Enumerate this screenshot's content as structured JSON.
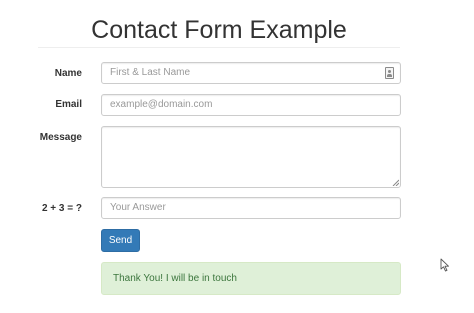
{
  "title": "Contact Form Example",
  "form": {
    "name": {
      "label": "Name",
      "placeholder": "First & Last Name",
      "value": ""
    },
    "email": {
      "label": "Email",
      "placeholder": "example@domain.com",
      "value": ""
    },
    "message": {
      "label": "Message",
      "value": ""
    },
    "captcha": {
      "label": "2 + 3 = ?",
      "placeholder": "Your Answer",
      "value": ""
    },
    "send_label": "Send"
  },
  "alert": {
    "text": "Thank You! I will be in touch",
    "type": "success"
  },
  "icons": {
    "name_field": "contact-card-icon",
    "pointer": "mouse-cursor-icon"
  },
  "colors": {
    "primary": "#337ab7",
    "success_bg": "#dff0d8",
    "success_text": "#3c763d",
    "border": "#cccccc"
  }
}
